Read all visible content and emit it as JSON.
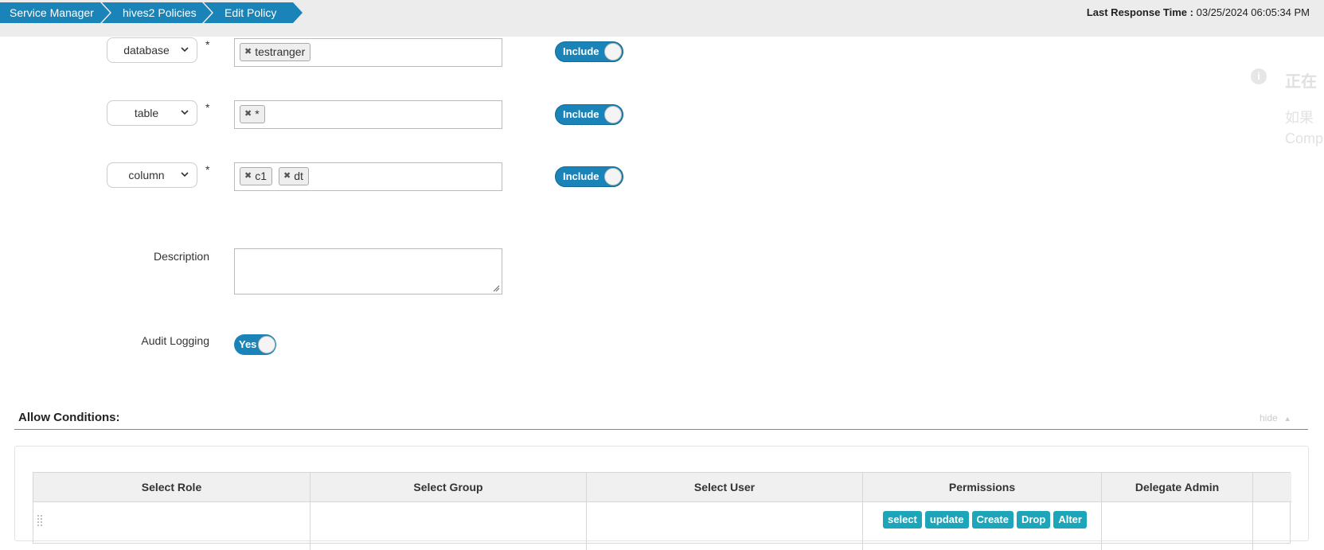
{
  "breadcrumb": [
    "Service Manager",
    "hives2 Policies",
    "Edit Policy"
  ],
  "last_response": {
    "label": "Last Response Time :",
    "value": "03/25/2024 06:05:34 PM"
  },
  "resources": [
    {
      "type": "database",
      "tags": [
        "testranger"
      ],
      "toggle": "Include"
    },
    {
      "type": "table",
      "tags": [
        "*"
      ],
      "toggle": "Include"
    },
    {
      "type": "column",
      "tags": [
        "c1",
        "dt"
      ],
      "toggle": "Include"
    }
  ],
  "required_mark": "*",
  "description": {
    "label": "Description",
    "value": ""
  },
  "audit_logging": {
    "label": "Audit Logging",
    "value": "Yes"
  },
  "side_panel": {
    "title": "正在",
    "line1": "如果",
    "line2": "Comp"
  },
  "allow": {
    "title": "Allow Conditions:",
    "hide_label": "hide",
    "columns": [
      "Select Role",
      "Select Group",
      "Select User",
      "Permissions",
      "Delegate Admin"
    ],
    "permissions": [
      "select",
      "update",
      "Create",
      "Drop",
      "Alter"
    ]
  },
  "colors": {
    "brand": "#1a84b8",
    "permission": "#1da5ba",
    "divider": "#3fa6a1"
  }
}
